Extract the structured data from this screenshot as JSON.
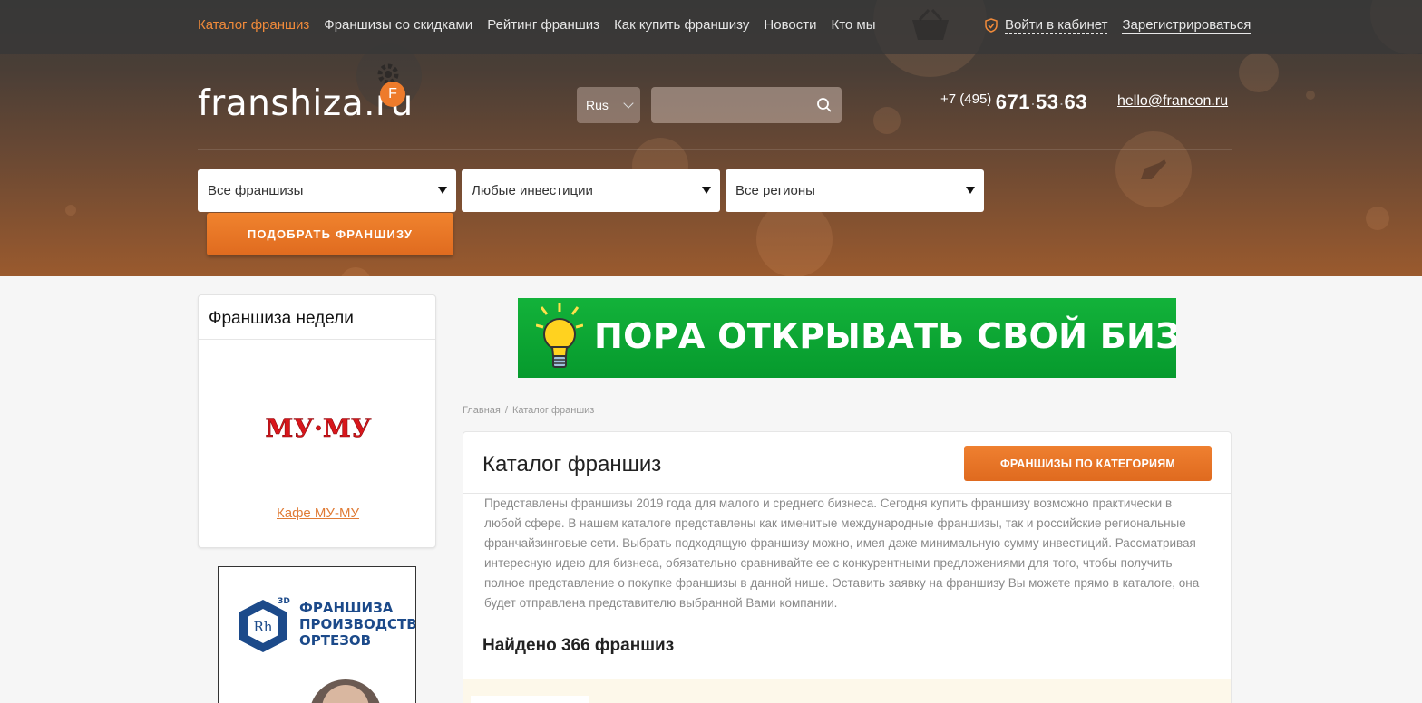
{
  "topnav": {
    "items": [
      "Каталог франшиз",
      "Франшизы со скидками",
      "Рейтинг франшиз",
      "Как купить франшизу",
      "Новости",
      "Кто мы"
    ],
    "active_index": 0
  },
  "auth": {
    "login": "Войти в кабинет",
    "register": "Зарегистрироваться"
  },
  "logo": {
    "text": "franshiza.ru",
    "badge": "F"
  },
  "lang": {
    "value": "Rus"
  },
  "search": {
    "value": ""
  },
  "contacts": {
    "phone_code": "+7 (495)",
    "phone_parts": [
      "671",
      "53",
      "63"
    ],
    "email": "hello@francon.ru"
  },
  "filters": {
    "category": "Все франшизы",
    "investment": "Любые инвестиции",
    "region": "Все регионы",
    "submit": "ПОДОБРАТЬ ФРАНШИЗУ"
  },
  "sidebar": {
    "week_title": "Франшиза недели",
    "week_logo_text": "МУ·МУ",
    "week_link": "Кафе МУ-МУ",
    "ad": {
      "logo_text": "Rh",
      "logo_sup": "3D",
      "lines": [
        "ФРАНШИЗА",
        "ПРОИЗВОДСТВА",
        "ОРТЕЗОВ"
      ]
    }
  },
  "banner": {
    "text": "ПОРА ОТКРЫВАТЬ СВОЙ БИЗНЕС!"
  },
  "breadcrumb": {
    "home": "Главная",
    "separator": "/",
    "current": "Каталог франшиз"
  },
  "catalog": {
    "title": "Каталог франшиз",
    "categories_button": "ФРАНШИЗЫ ПО КАТЕГОРИЯМ",
    "description": "Представлены франшизы 2019 года для малого и среднего бизнеса. Сегодня купить франшизу возможно практически в любой сфере. В нашем каталоге представлены как именитые международные франшизы, так и российские региональные франчайзинговые сети. Выбрать подходящую франшизу можно, имея даже минимальную сумму инвестиций. Рассматривая интересную идею для бизнеса, обязательно сравнивайте ее с конкурентными предложениями для того, чтобы получить полное представление о покупке франшизы в данной нише. Оставить заявку на франшизу Вы можете прямо в каталоге, она будет отправлена представителю выбранной Вами компании.",
    "found": "Найдено 366 франшиз"
  },
  "colors": {
    "accent": "#f08a3a",
    "button": "#e06b1f",
    "banner_green": "#0aa331",
    "link": "#e07b35"
  }
}
